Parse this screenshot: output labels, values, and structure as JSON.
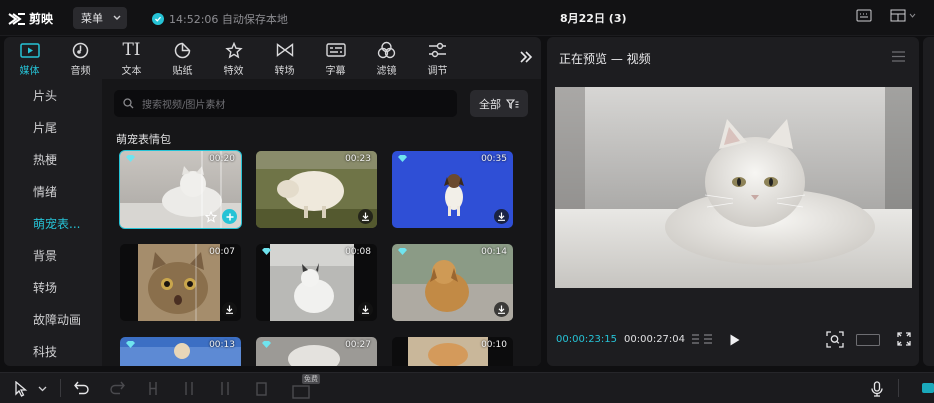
{
  "app": {
    "name": "剪映"
  },
  "titlebar": {
    "menu_label": "菜单",
    "save_status": "14:52:06 自动保存本地",
    "project_title": "8月22日 (3)"
  },
  "tool_tabs": [
    {
      "label": "媒体",
      "icon": "media-icon",
      "active": true
    },
    {
      "label": "音频",
      "icon": "audio-icon",
      "active": false
    },
    {
      "label": "文本",
      "icon": "text-icon",
      "active": false
    },
    {
      "label": "贴纸",
      "icon": "sticker-icon",
      "active": false
    },
    {
      "label": "特效",
      "icon": "effects-icon",
      "active": false
    },
    {
      "label": "转场",
      "icon": "transition-icon",
      "active": false
    },
    {
      "label": "字幕",
      "icon": "subtitle-icon",
      "active": false
    },
    {
      "label": "滤镜",
      "icon": "filter-icon",
      "active": false
    },
    {
      "label": "调节",
      "icon": "adjust-icon",
      "active": false
    }
  ],
  "categories": [
    {
      "label": "片头",
      "active": false
    },
    {
      "label": "片尾",
      "active": false
    },
    {
      "label": "热梗",
      "active": false
    },
    {
      "label": "情绪",
      "active": false
    },
    {
      "label": "萌宠表...",
      "active": true
    },
    {
      "label": "背景",
      "active": false
    },
    {
      "label": "转场",
      "active": false
    },
    {
      "label": "故障动画",
      "active": false
    },
    {
      "label": "科技",
      "active": false
    }
  ],
  "search": {
    "placeholder": "搜索视频/图片素材"
  },
  "filter": {
    "label": "全部"
  },
  "section": {
    "title": "萌宠表情包"
  },
  "media_cards": [
    {
      "duration": "00:20",
      "subject": "white cat on bed",
      "selected": true,
      "vip": true
    },
    {
      "duration": "00:23",
      "subject": "sheep on grass",
      "selected": false,
      "vip": false
    },
    {
      "duration": "00:35",
      "subject": "dog on blue screen",
      "selected": false,
      "vip": true
    },
    {
      "duration": "00:07",
      "subject": "surprised cat",
      "selected": false,
      "vip": false
    },
    {
      "duration": "00:08",
      "subject": "cat in room",
      "selected": false,
      "vip": true
    },
    {
      "duration": "00:14",
      "subject": "dog on road",
      "selected": false,
      "vip": true
    },
    {
      "duration": "00:13",
      "subject": "animal on blue",
      "selected": false,
      "vip": true
    },
    {
      "duration": "00:27",
      "subject": "animal white",
      "selected": false,
      "vip": true
    },
    {
      "duration": "00:10",
      "subject": "dog",
      "selected": false,
      "vip": false
    }
  ],
  "player": {
    "title": "正在预览 — 视频",
    "current_time": "00:00:23:15",
    "total_time": "00:00:27:04"
  },
  "bottombar": {
    "free_badge": "免费"
  },
  "colors": {
    "accent": "#26c3d6",
    "panel": "#1d1d20",
    "background": "#0f0f11"
  }
}
